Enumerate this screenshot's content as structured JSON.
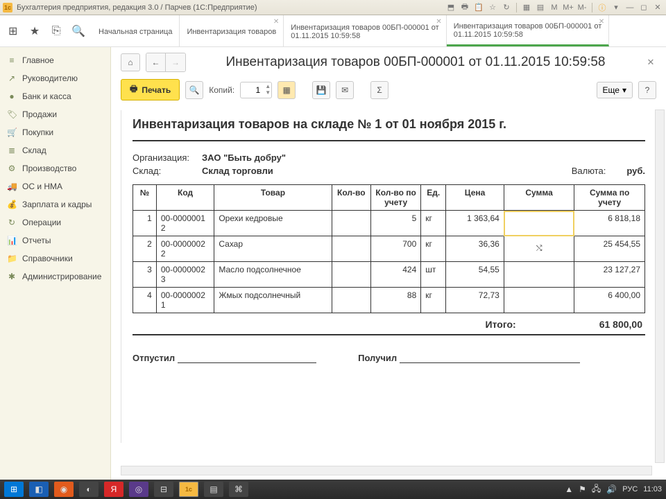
{
  "titlebar": {
    "icon": "1c",
    "title": "Бухгалтерия предприятия, редакция 3.0 / Парчев  (1С:Предприятие)",
    "m_buttons": [
      "М",
      "М+",
      "М-"
    ]
  },
  "iconbar": {
    "apps": "⊞",
    "star": "★",
    "copy": "⎘",
    "search": "🔍"
  },
  "tabs": [
    {
      "line1": "Начальная страница",
      "line2": "",
      "closable": false
    },
    {
      "line1": "Инвентаризация товаров",
      "line2": "",
      "closable": true
    },
    {
      "line1": "Инвентаризация товаров 00БП-000001 от",
      "line2": "01.11.2015 10:59:58",
      "closable": true
    },
    {
      "line1": "Инвентаризация товаров 00БП-000001 от",
      "line2": "01.11.2015 10:59:58",
      "closable": true,
      "active": true
    }
  ],
  "sidebar": [
    {
      "icon": "≡",
      "label": "Главное"
    },
    {
      "icon": "↗",
      "label": "Руководителю"
    },
    {
      "icon": "●",
      "label": "Банк и касса"
    },
    {
      "icon": "🏷",
      "label": "Продажи"
    },
    {
      "icon": "🛒",
      "label": "Покупки"
    },
    {
      "icon": "≣",
      "label": "Склад"
    },
    {
      "icon": "⚙",
      "label": "Производство"
    },
    {
      "icon": "🚚",
      "label": "ОС и НМА"
    },
    {
      "icon": "💰",
      "label": "Зарплата и кадры"
    },
    {
      "icon": "↻",
      "label": "Операции"
    },
    {
      "icon": "📊",
      "label": "Отчеты"
    },
    {
      "icon": "📁",
      "label": "Справочники"
    },
    {
      "icon": "✱",
      "label": "Администрирование"
    }
  ],
  "doc": {
    "title": "Инвентаризация товаров 00БП-000001 от 01.11.2015 10:59:58",
    "print_label": "Печать",
    "copies_label": "Копий:",
    "copies_value": "1",
    "more_label": "Еще",
    "help_label": "?",
    "sheet_title": "Инвентаризация товаров на складе № 1 от 01 ноября 2015 г.",
    "org_label": "Организация:",
    "org_value": "ЗАО \"Быть добру\"",
    "warehouse_label": "Склад:",
    "warehouse_value": "Склад торговли",
    "currency_label": "Валюта:",
    "currency_value": "руб."
  },
  "table": {
    "headers": [
      "№",
      "Код",
      "Товар",
      "Кол-во",
      "Кол-во по учету",
      "Ед.",
      "Цена",
      "Сумма",
      "Сумма по учету"
    ],
    "rows": [
      {
        "n": "1",
        "code": "00-00000012",
        "name": "Орехи кедровые",
        "qty": "",
        "qty_acc": "5",
        "unit": "кг",
        "price": "1 363,64",
        "sum": "",
        "sum_acc": "6 818,18",
        "hl": true
      },
      {
        "n": "2",
        "code": "00-00000022",
        "name": "Сахар",
        "qty": "",
        "qty_acc": "700",
        "unit": "кг",
        "price": "36,36",
        "sum": "",
        "sum_acc": "25 454,55",
        "cursor": true
      },
      {
        "n": "3",
        "code": "00-00000023",
        "name": "Масло подсолнечное",
        "qty": "",
        "qty_acc": "424",
        "unit": "шт",
        "price": "54,55",
        "sum": "",
        "sum_acc": "23 127,27"
      },
      {
        "n": "4",
        "code": "00-00000021",
        "name": "Жмых подсолнечный",
        "qty": "",
        "qty_acc": "88",
        "unit": "кг",
        "price": "72,73",
        "sum": "",
        "sum_acc": "6 400,00"
      }
    ],
    "total_label": "Итого:",
    "total_value": "61 800,00"
  },
  "signatures": {
    "released": "Отпустил",
    "received": "Получил"
  },
  "taskbar": {
    "lang": "РУС",
    "time": "11:03"
  }
}
